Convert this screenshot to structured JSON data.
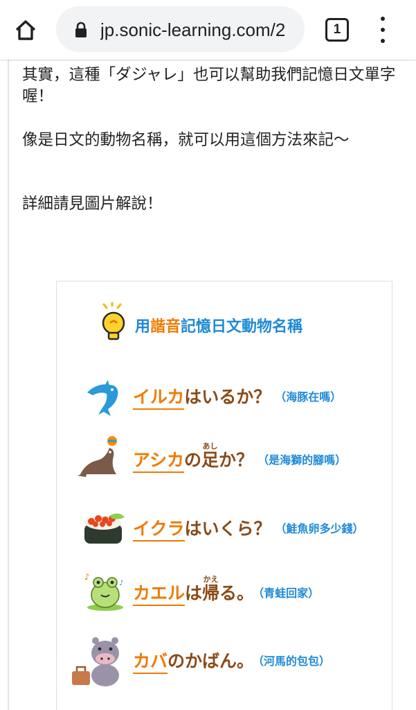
{
  "browser": {
    "url": "jp.sonic-learning.com/2",
    "tab_count": "1",
    "icons": [
      "home-icon",
      "lock-icon",
      "tabs-icon",
      "menu-icon"
    ]
  },
  "article": {
    "p1": "其實，這種「ダジャレ」也可以幫助我們記憶日文單字喔！",
    "p2": "像是日文的動物名稱，就可以用這個方法來記～",
    "p3": "詳細請見圖片解說！"
  },
  "card": {
    "title": {
      "part1": "用",
      "part2": "諧音",
      "part3": "記憶日文動物名稱"
    },
    "rows": [
      {
        "animal": "dolphin",
        "kata": "イルカ",
        "rest": "はいるか？",
        "gloss": "（海豚在嗎）"
      },
      {
        "animal": "sea-lion",
        "kata": "アシカ",
        "pre": "の",
        "kanji": "足",
        "furigana": "あし",
        "rest": "か？",
        "gloss": "（是海獅的腳嗎）"
      },
      {
        "animal": "salmon-roe",
        "kata": "イクラ",
        "rest": "はいくら？",
        "gloss": "（鮭魚卵多少錢）"
      },
      {
        "animal": "frog",
        "kata": "カエル",
        "pre": "は",
        "kanji": "帰",
        "furigana": "かえ",
        "rest": "る。",
        "gloss": "（青蛙回家）"
      },
      {
        "animal": "hippo",
        "kata": "カバ",
        "rest": "のかばん。",
        "gloss": "（河馬的包包）"
      }
    ]
  },
  "colors": {
    "accent_blue": "#1f8ad6",
    "accent_orange": "#ef7a00",
    "text_brown": "#8a4a17"
  }
}
